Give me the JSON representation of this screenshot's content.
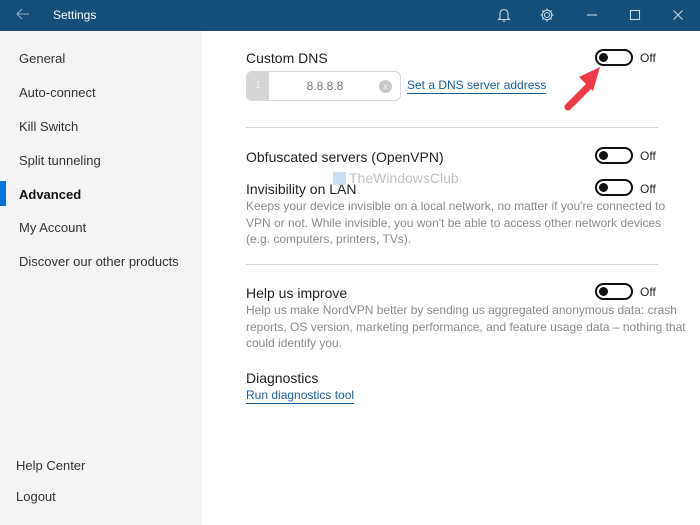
{
  "titlebar": {
    "title": "Settings",
    "back_icon": "arrow-left-icon",
    "actions": [
      "bell-icon",
      "gear-icon",
      "minimize-icon",
      "maximize-icon",
      "close-icon"
    ]
  },
  "sidebar": {
    "items": [
      {
        "label": "General"
      },
      {
        "label": "Auto-connect"
      },
      {
        "label": "Kill Switch"
      },
      {
        "label": "Split tunneling"
      },
      {
        "label": "Advanced",
        "active": true
      },
      {
        "label": "My Account"
      },
      {
        "label": "Discover our other products"
      }
    ],
    "footer": [
      {
        "label": "Help Center"
      },
      {
        "label": "Logout"
      }
    ]
  },
  "main": {
    "custom_dns": {
      "label": "Custom DNS",
      "toggle_state": "Off",
      "entry_index": "1",
      "entry_value": "8.8.8.8",
      "clear_glyph": "x",
      "link": "Set a DNS server address"
    },
    "obfuscated": {
      "label": "Obfuscated servers (OpenVPN)",
      "toggle_state": "Off"
    },
    "invisibility": {
      "label": "Invisibility on LAN",
      "toggle_state": "Off",
      "description": "Keeps your device invisible on a local network, no matter if you're connected to VPN or not. While invisible, you won't be able to access other network devices (e.g. computers, printers, TVs)."
    },
    "help_improve": {
      "label": "Help us improve",
      "toggle_state": "Off",
      "description": "Help us make NordVPN better by sending us aggregated anonymous data: crash reports, OS version, marketing performance, and feature usage data – nothing that could identify you."
    },
    "diagnostics": {
      "label": "Diagnostics",
      "link": "Run diagnostics tool"
    }
  },
  "watermark": {
    "text": "TheWindowsClub"
  },
  "colors": {
    "titlebar": "#144f79",
    "accent": "#0a74d4",
    "link": "#1c5e96",
    "annotation_arrow": "#ee3b45"
  }
}
